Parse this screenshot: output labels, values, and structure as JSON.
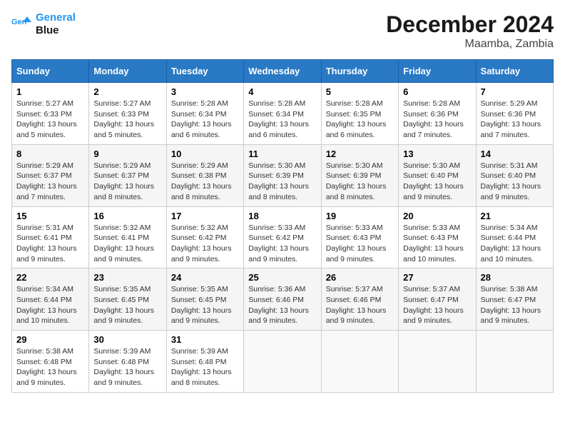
{
  "logo": {
    "line1": "General",
    "line2": "Blue"
  },
  "title": "December 2024",
  "location": "Maamba, Zambia",
  "days_of_week": [
    "Sunday",
    "Monday",
    "Tuesday",
    "Wednesday",
    "Thursday",
    "Friday",
    "Saturday"
  ],
  "weeks": [
    [
      {
        "day": "1",
        "sunrise": "5:27 AM",
        "sunset": "6:33 PM",
        "daylight": "13 hours and 5 minutes."
      },
      {
        "day": "2",
        "sunrise": "5:27 AM",
        "sunset": "6:33 PM",
        "daylight": "13 hours and 5 minutes."
      },
      {
        "day": "3",
        "sunrise": "5:28 AM",
        "sunset": "6:34 PM",
        "daylight": "13 hours and 6 minutes."
      },
      {
        "day": "4",
        "sunrise": "5:28 AM",
        "sunset": "6:34 PM",
        "daylight": "13 hours and 6 minutes."
      },
      {
        "day": "5",
        "sunrise": "5:28 AM",
        "sunset": "6:35 PM",
        "daylight": "13 hours and 6 minutes."
      },
      {
        "day": "6",
        "sunrise": "5:28 AM",
        "sunset": "6:36 PM",
        "daylight": "13 hours and 7 minutes."
      },
      {
        "day": "7",
        "sunrise": "5:29 AM",
        "sunset": "6:36 PM",
        "daylight": "13 hours and 7 minutes."
      }
    ],
    [
      {
        "day": "8",
        "sunrise": "5:29 AM",
        "sunset": "6:37 PM",
        "daylight": "13 hours and 7 minutes."
      },
      {
        "day": "9",
        "sunrise": "5:29 AM",
        "sunset": "6:37 PM",
        "daylight": "13 hours and 8 minutes."
      },
      {
        "day": "10",
        "sunrise": "5:29 AM",
        "sunset": "6:38 PM",
        "daylight": "13 hours and 8 minutes."
      },
      {
        "day": "11",
        "sunrise": "5:30 AM",
        "sunset": "6:39 PM",
        "daylight": "13 hours and 8 minutes."
      },
      {
        "day": "12",
        "sunrise": "5:30 AM",
        "sunset": "6:39 PM",
        "daylight": "13 hours and 8 minutes."
      },
      {
        "day": "13",
        "sunrise": "5:30 AM",
        "sunset": "6:40 PM",
        "daylight": "13 hours and 9 minutes."
      },
      {
        "day": "14",
        "sunrise": "5:31 AM",
        "sunset": "6:40 PM",
        "daylight": "13 hours and 9 minutes."
      }
    ],
    [
      {
        "day": "15",
        "sunrise": "5:31 AM",
        "sunset": "6:41 PM",
        "daylight": "13 hours and 9 minutes."
      },
      {
        "day": "16",
        "sunrise": "5:32 AM",
        "sunset": "6:41 PM",
        "daylight": "13 hours and 9 minutes."
      },
      {
        "day": "17",
        "sunrise": "5:32 AM",
        "sunset": "6:42 PM",
        "daylight": "13 hours and 9 minutes."
      },
      {
        "day": "18",
        "sunrise": "5:33 AM",
        "sunset": "6:42 PM",
        "daylight": "13 hours and 9 minutes."
      },
      {
        "day": "19",
        "sunrise": "5:33 AM",
        "sunset": "6:43 PM",
        "daylight": "13 hours and 9 minutes."
      },
      {
        "day": "20",
        "sunrise": "5:33 AM",
        "sunset": "6:43 PM",
        "daylight": "13 hours and 10 minutes."
      },
      {
        "day": "21",
        "sunrise": "5:34 AM",
        "sunset": "6:44 PM",
        "daylight": "13 hours and 10 minutes."
      }
    ],
    [
      {
        "day": "22",
        "sunrise": "5:34 AM",
        "sunset": "6:44 PM",
        "daylight": "13 hours and 10 minutes."
      },
      {
        "day": "23",
        "sunrise": "5:35 AM",
        "sunset": "6:45 PM",
        "daylight": "13 hours and 9 minutes."
      },
      {
        "day": "24",
        "sunrise": "5:35 AM",
        "sunset": "6:45 PM",
        "daylight": "13 hours and 9 minutes."
      },
      {
        "day": "25",
        "sunrise": "5:36 AM",
        "sunset": "6:46 PM",
        "daylight": "13 hours and 9 minutes."
      },
      {
        "day": "26",
        "sunrise": "5:37 AM",
        "sunset": "6:46 PM",
        "daylight": "13 hours and 9 minutes."
      },
      {
        "day": "27",
        "sunrise": "5:37 AM",
        "sunset": "6:47 PM",
        "daylight": "13 hours and 9 minutes."
      },
      {
        "day": "28",
        "sunrise": "5:38 AM",
        "sunset": "6:47 PM",
        "daylight": "13 hours and 9 minutes."
      }
    ],
    [
      {
        "day": "29",
        "sunrise": "5:38 AM",
        "sunset": "6:48 PM",
        "daylight": "13 hours and 9 minutes."
      },
      {
        "day": "30",
        "sunrise": "5:39 AM",
        "sunset": "6:48 PM",
        "daylight": "13 hours and 9 minutes."
      },
      {
        "day": "31",
        "sunrise": "5:39 AM",
        "sunset": "6:48 PM",
        "daylight": "13 hours and 8 minutes."
      },
      null,
      null,
      null,
      null
    ]
  ]
}
